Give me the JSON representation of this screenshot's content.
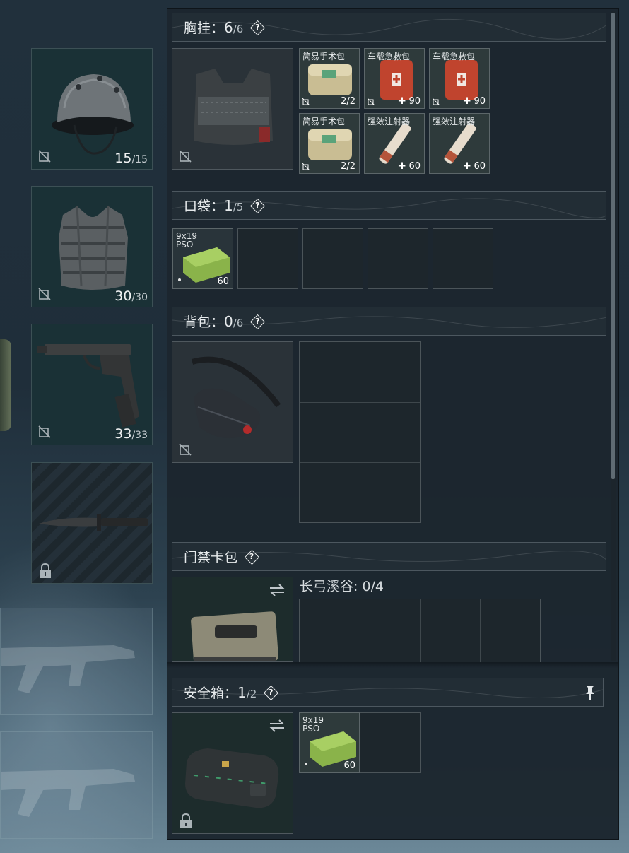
{
  "equipment": {
    "helmet": {
      "current": "15",
      "max": "/15"
    },
    "armor": {
      "current": "30",
      "max": "/30"
    },
    "pistol": {
      "current": "33",
      "max": "/33"
    },
    "melee": {
      "locked": true
    }
  },
  "sections": {
    "chest_rig": {
      "title": "胸挂：",
      "current": "6",
      "max": "/6",
      "help": "?"
    },
    "pockets": {
      "title": "口袋：",
      "current": "1",
      "max": "/5",
      "help": "?"
    },
    "backpack": {
      "title": "背包：",
      "current": "0",
      "max": "/6",
      "help": "?"
    },
    "keycard": {
      "title": "门禁卡包",
      "help": "?",
      "capacity_label": "长弓溪谷: 0/4"
    },
    "safebox": {
      "title": "安全箱：",
      "current": "1",
      "max": "/2",
      "help": "?"
    }
  },
  "chest_rig_items": [
    {
      "name": "简易手术包",
      "qty": "2/2"
    },
    {
      "name": "车载急救包",
      "qty": "✚ 90"
    },
    {
      "name": "车载急救包",
      "qty": "✚ 90"
    },
    {
      "name": "简易手术包",
      "qty": "2/2"
    },
    {
      "name": "强效注射器",
      "qty": "✚ 60"
    },
    {
      "name": "强效注射器",
      "qty": "✚ 60"
    }
  ],
  "pocket_items": [
    {
      "name_line1": "9x19",
      "name_line2": "PSO",
      "qty": "60"
    }
  ],
  "safebox_items": [
    {
      "name_line1": "9x19",
      "name_line2": "PSO",
      "qty": "60"
    }
  ]
}
